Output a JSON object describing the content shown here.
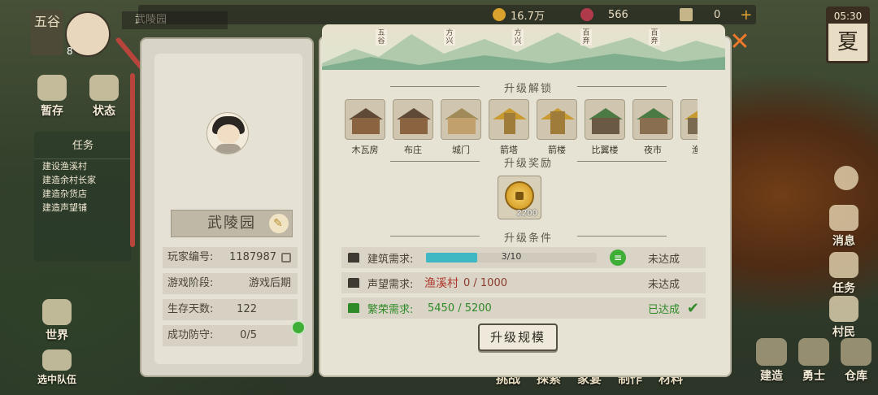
{
  "hud": {
    "region_badge": "五谷",
    "player_level": "8",
    "village_name": "武陵园",
    "copper": "16.7万",
    "jade": "566",
    "scroll": "0",
    "time": "05:30",
    "season": "夏"
  },
  "left_nav": {
    "temp_label": "暂存",
    "status_label": "状态",
    "task_title": "任务",
    "tasks": [
      "建设渔溪村",
      "建造余村长家",
      "建造杂货店",
      "建造声望铺"
    ],
    "world_label": "世界",
    "team_label": "选中队伍"
  },
  "profile": {
    "name": "武陵园",
    "rows": [
      {
        "label": "玩家编号:",
        "value": "1187987"
      },
      {
        "label": "游戏阶段:",
        "value": "游戏后期"
      },
      {
        "label": "生存天数:",
        "value": "122"
      },
      {
        "label": "成功防守:",
        "value": "0/5"
      }
    ]
  },
  "banner_tags": [
    "五谷",
    "方兴",
    "方兴",
    "百弃",
    "百弃"
  ],
  "sections": {
    "unlock": "升级解锁",
    "reward": "升级奖励",
    "conditions": "升级条件"
  },
  "buildings": [
    "木瓦房",
    "布庄",
    "城门",
    "箭塔",
    "箭楼",
    "比翼楼",
    "夜市",
    "渔溪"
  ],
  "reward_amount": "2200",
  "conditions": [
    {
      "label": "建筑需求:",
      "progress_text": "3/10",
      "progress": 0.3,
      "status": "未达成"
    },
    {
      "label": "声望需求:",
      "village": "渔溪村",
      "value": "0 / 1000",
      "status": "未达成"
    },
    {
      "label": "繁荣需求:",
      "value": "5450 / 5200",
      "status": "已达成"
    }
  ],
  "upgrade_button": "升级规模",
  "bottom_nav": [
    "挑战",
    "探索",
    "家宴",
    "制作",
    "材料"
  ],
  "right_nav": {
    "messages": "消息",
    "tasks": "任务",
    "villagers": "村民",
    "build": "建造",
    "warrior": "勇士",
    "warehouse": "仓库"
  },
  "colors": {
    "accent_close": "#f07a2a",
    "progress": "#3fb8c3",
    "ok": "#2f8a28",
    "warn": "#b03a2e"
  }
}
